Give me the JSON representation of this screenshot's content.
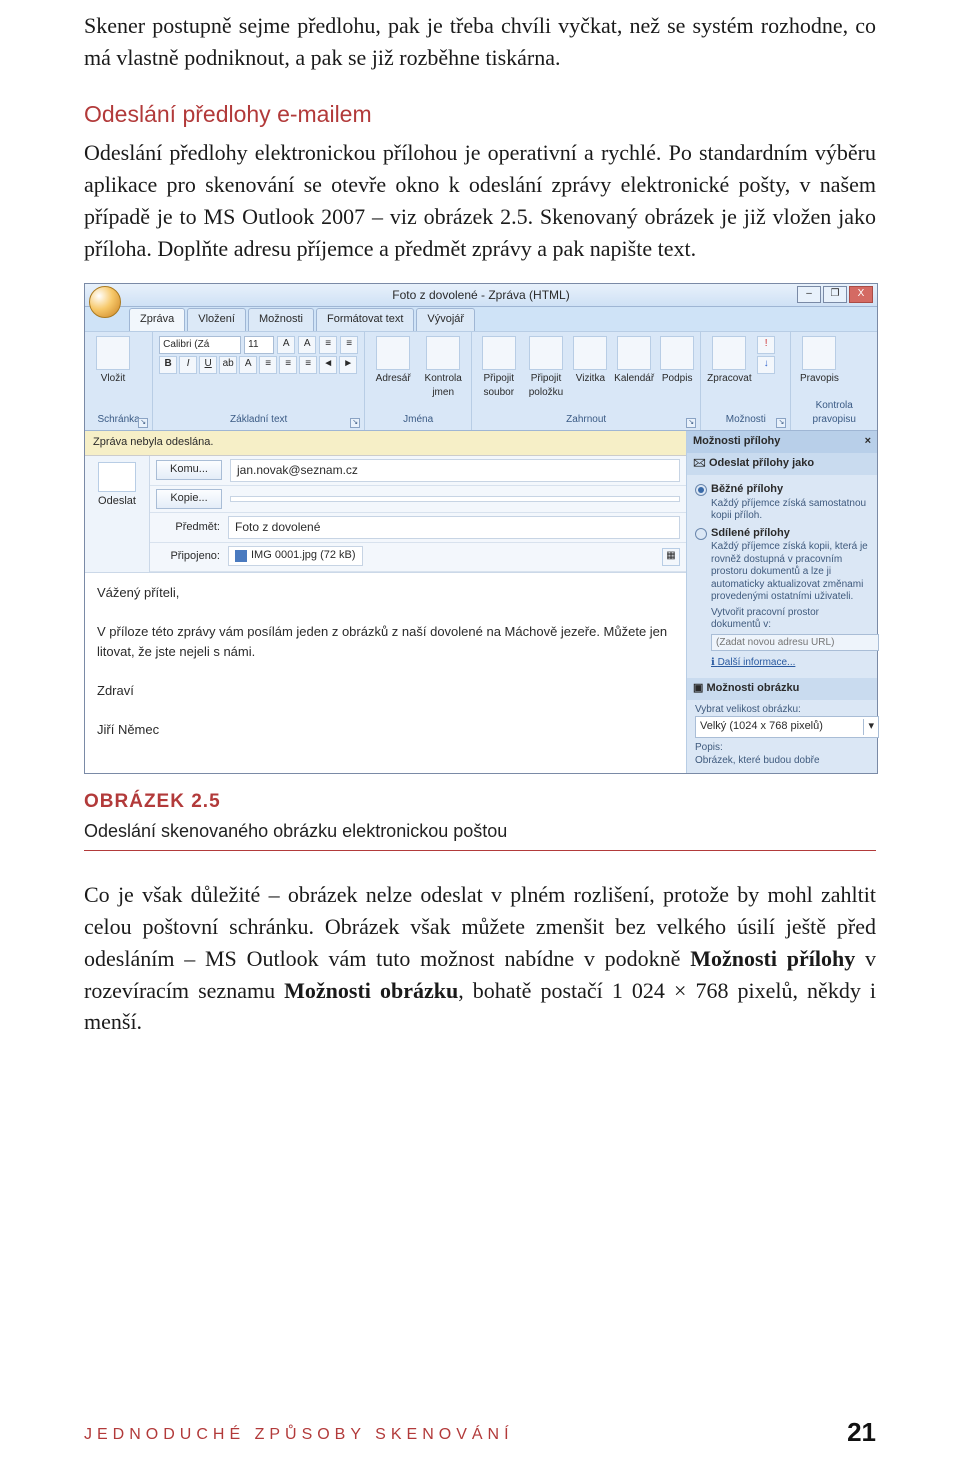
{
  "paras": {
    "p1": "Skener postupně sejme předlohu, pak je třeba chvíli vyčkat, než se systém rozhodne, co má vlastně podniknout, a pak se již rozběhne tiskárna.",
    "p2": "Odeslání předlohy elektronickou přílohou je operativní a rychlé. Po standardním výběru aplikace pro skenování se otevře okno k odeslání zprávy elektronické pošty, v našem případě je to MS Outlook 2007 – viz obrázek 2.5. Skenovaný obrázek je již vložen jako příloha. Doplňte adresu příjemce a předmět zprávy a pak napište text.",
    "p3a": "Co je však důležité – obrázek nelze odeslat v plném rozlišení, protože by mohl zahltit celou poštovní schránku. Obrázek však můžete zmenšit bez velkého úsilí ještě před odesláním – MS Outlook vám tuto možnost nabídne v podokně ",
    "p3b": " v rozevíracím seznamu ",
    "p3c": ", bohatě postačí 1 024 × 768 pixelů, někdy i menší.",
    "bold1": "Možnosti přílohy",
    "bold2": "Možnosti obrázku"
  },
  "sec_head": "Odeslání předlohy e-mailem",
  "fig": {
    "title": "OBRÁZEK 2.5",
    "caption": "Odeslání skenovaného obrázku elektronickou poštou"
  },
  "footer": {
    "section": "JEDNODUCHÉ ZPŮSOBY SKENOVÁNÍ",
    "page": "21"
  },
  "outlook": {
    "title": "Foto z dovolené - Zpráva (HTML)",
    "winbtns": {
      "min": "–",
      "max": "❐",
      "close": "X"
    },
    "tabs": [
      "Zpráva",
      "Vložení",
      "Možnosti",
      "Formátovat text",
      "Vývojář"
    ],
    "ribbon": {
      "clipboard": {
        "btn": "Vložit",
        "label": "Schránka"
      },
      "font": {
        "name": "Calibri (Zá",
        "size": "11",
        "label": "Základní text"
      },
      "names": {
        "btns": [
          "Adresář",
          "Kontrola jmen"
        ],
        "label": "Jména"
      },
      "include": {
        "btns": [
          "Připojit soubor",
          "Připojit položku",
          "Vizitka",
          "Kalendář",
          "Podpis"
        ],
        "label": "Zahrnout"
      },
      "options": {
        "btns": [
          "Zpracovat",
          "!"
        ],
        "label": "Možnosti"
      },
      "proof": {
        "btn": "Pravopis",
        "label": "Kontrola pravopisu"
      }
    },
    "infobar": "Zpráva nebyla odeslána.",
    "send": "Odeslat",
    "fields": {
      "to_btn": "Komu...",
      "to_val": "jan.novak@seznam.cz",
      "cc_btn": "Kopie...",
      "cc_val": "",
      "subj_lbl": "Předmět:",
      "subj_val": "Foto z dovolené",
      "att_lbl": "Připojeno:",
      "att_val": "IMG 0001.jpg (72 kB)"
    },
    "body": {
      "l1": "Vážený příteli,",
      "l2": "V příloze této zprávy vám posílám jeden z obrázků z naší dovolené na Máchově jezeře. Můžete jen litovat, že jste nejeli s námi.",
      "l3": "Zdraví",
      "l4": "Jiří Němec"
    },
    "side": {
      "header": "Možnosti přílohy",
      "close": "×",
      "sec1": "Odeslat přílohy jako",
      "opt1_t": "Běžné přílohy",
      "opt1_d": "Každý příjemce získá samostatnou kopii příloh.",
      "opt2_t": "Sdílené přílohy",
      "opt2_d": "Každý příjemce získá kopii, která je rovněž dostupná v pracovním prostoru dokumentů a lze ji automaticky aktualizovat změnami provedenými ostatními uživateli.",
      "opt2_link": "Vytvořit pracovní prostor dokumentů v:",
      "url_ph": "(Zadat novou adresu URL)",
      "more": "Další informace...",
      "sec2": "Možnosti obrázku",
      "size_lbl": "Vybrat velikost obrázku:",
      "size_val": "Velký (1024 x 768 pixelů)",
      "popis_lbl": "Popis:",
      "popis_val": "Obrázek, které budou dobře"
    }
  }
}
